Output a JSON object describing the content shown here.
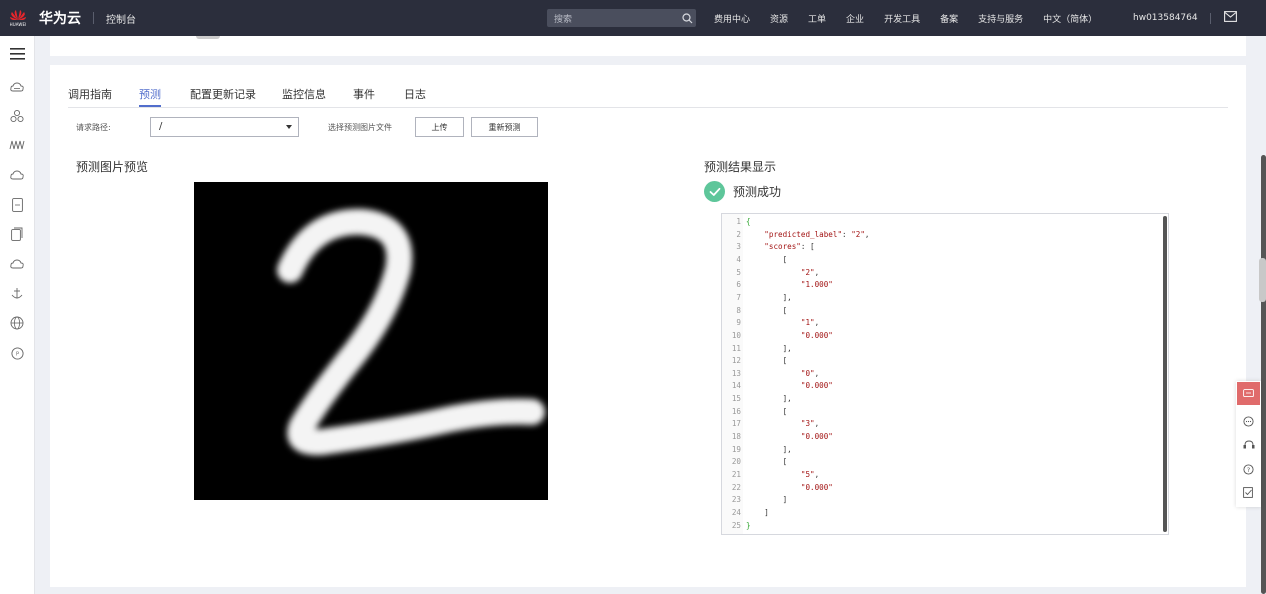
{
  "header": {
    "logo_text": "HUAWEI",
    "brand": "华为云",
    "console": "控制台",
    "search_placeholder": "搜索",
    "nav": [
      "费用中心",
      "资源",
      "工单",
      "企业",
      "开发工具",
      "备案",
      "支持与服务",
      "中文（简体）"
    ],
    "user": "hw013584764"
  },
  "sidebar": {
    "icons": [
      "menu-icon",
      "cloud-icon",
      "cluster-icon",
      "chart-icon",
      "cloud-storage-icon",
      "document-icon",
      "copy-icon",
      "cloud-outline-icon",
      "anchor-icon",
      "globe-icon",
      "chat-icon"
    ]
  },
  "tabs": [
    "调用指南",
    "预测",
    "配置更新记录",
    "监控信息",
    "事件",
    "日志"
  ],
  "request": {
    "path_label": "请求路径:",
    "path_value": "/",
    "select_file_label": "选择预测图片文件",
    "upload_button": "上传",
    "repredict_button": "重新预测"
  },
  "preview": {
    "title": "预测图片预览",
    "digit": "2"
  },
  "result": {
    "title": "预测结果显示",
    "status": "预测成功",
    "lines": [
      "{",
      "    \"predicted_label\": \"2\",",
      "    \"scores\": [",
      "        [",
      "            \"2\",",
      "            \"1.000\"",
      "        ],",
      "        [",
      "            \"1\",",
      "            \"0.000\"",
      "        ],",
      "        [",
      "            \"0\",",
      "            \"0.000\"",
      "        ],",
      "        [",
      "            \"3\",",
      "            \"0.000\"",
      "        ],",
      "        [",
      "            \"5\",",
      "            \"0.000\"",
      "        ]",
      "    ]",
      "}"
    ]
  },
  "colors": {
    "accent": "#526ecc",
    "success": "#5ec69a",
    "topbar": "#2b2e3c",
    "feedback": "#e06b6b"
  }
}
